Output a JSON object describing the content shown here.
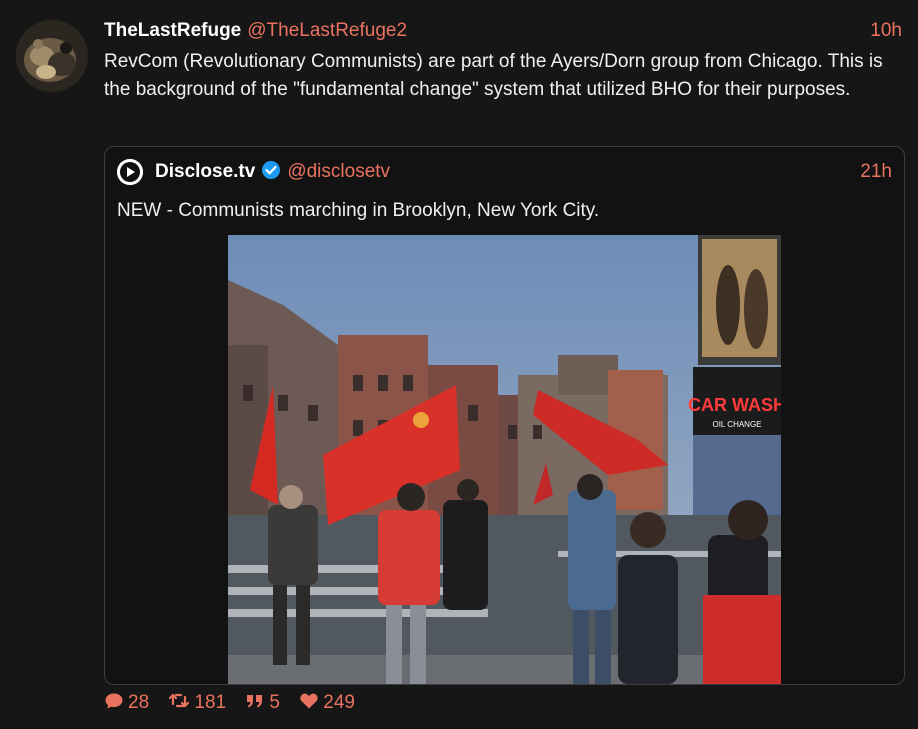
{
  "post": {
    "display_name": "TheLastRefuge",
    "handle": "@TheLastRefuge2",
    "time": "10h",
    "text": "RevCom (Revolutionary Communists) are part of the Ayers/Dorn group from Chicago. This is the background of the \"fundamental change\" system that utilized BHO for their purposes."
  },
  "quote": {
    "display_name": "Disclose.tv",
    "handle": "@disclosetv",
    "time": "21h",
    "text": "NEW - Communists marching in Brooklyn, New York City.",
    "media": {
      "billboard_text": "CAR WASH",
      "billboard_subtext": "OIL CHANGE"
    }
  },
  "actions": {
    "replies": "28",
    "reposts": "181",
    "quotes": "5",
    "likes": "249"
  },
  "colors": {
    "accent": "#e9735f",
    "background": "#161616",
    "verified": "#1d9bf0"
  },
  "icons": [
    "reply-icon",
    "repost-icon",
    "quote-icon",
    "heart-icon",
    "verified-badge-icon"
  ]
}
